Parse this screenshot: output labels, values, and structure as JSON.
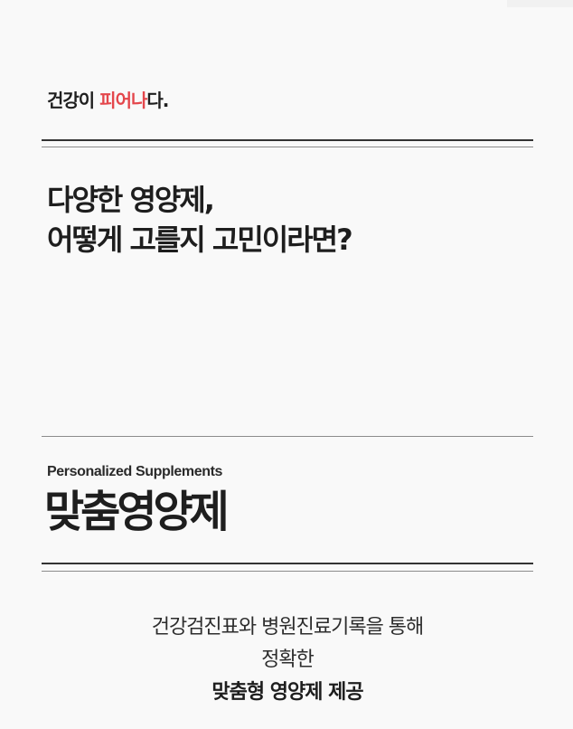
{
  "brand": {
    "prefix": "건강이 ",
    "accent": "피어나",
    "suffix": "다."
  },
  "headline": {
    "line1": "다양한 영양제,",
    "line2": "어떻게 고를지 고민이라면?"
  },
  "product": {
    "eyebrow": "Personalized Supplements",
    "title": "맞춤영양제"
  },
  "description": {
    "line1": "건강검진표와 병원진료기록을 통해",
    "line2": "정확한",
    "line3": "맞춤형 영양제  제공"
  },
  "colors": {
    "accent": "#e4474c",
    "text": "#1e1e1e",
    "background": "#f9f9f9"
  }
}
